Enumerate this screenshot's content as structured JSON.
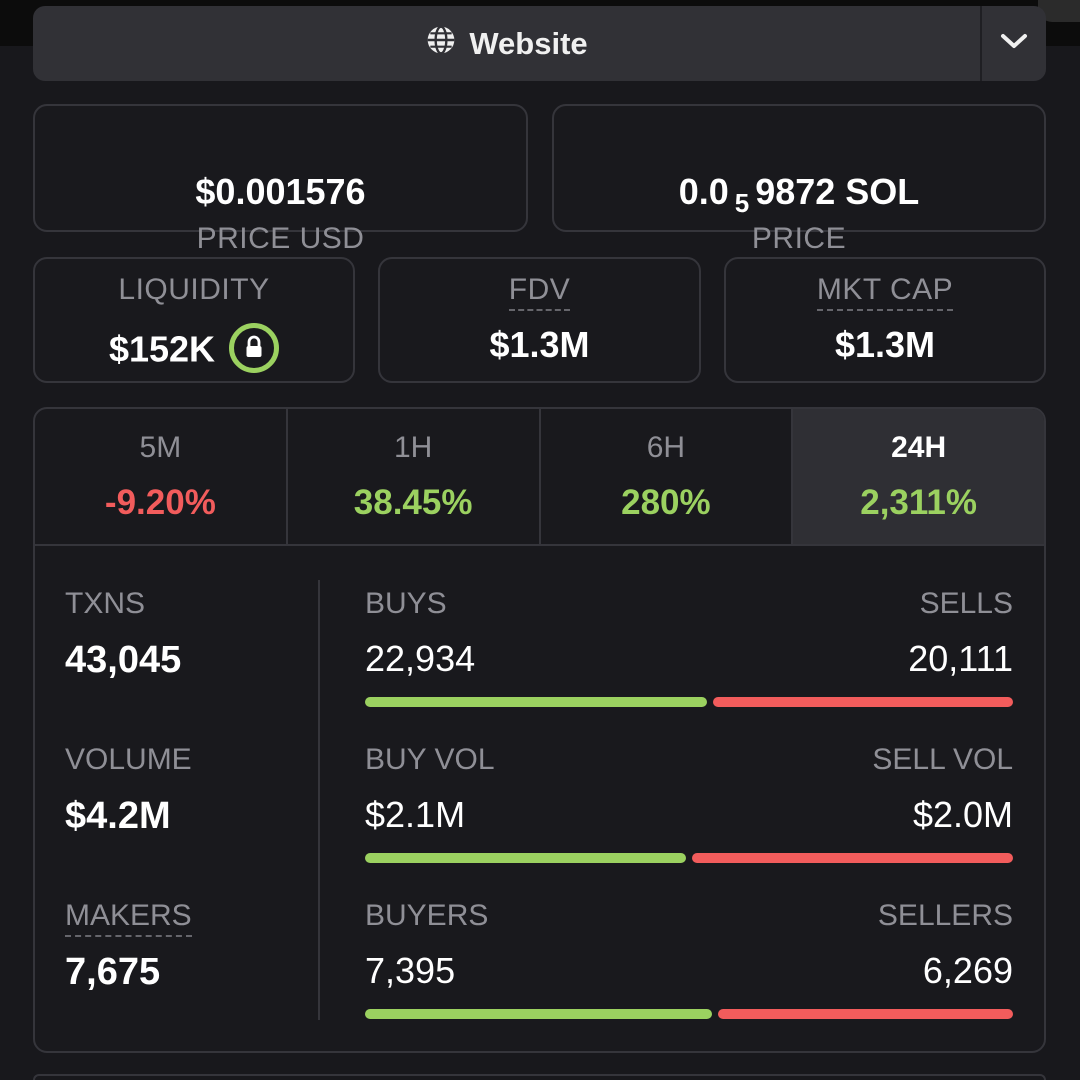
{
  "website_button": {
    "label": "Website",
    "icon": "globe-icon",
    "toggle_icon": "chevron-down-icon"
  },
  "price_usd": {
    "label": "PRICE USD",
    "value": "$0.001576"
  },
  "price_sol": {
    "label": "PRICE",
    "prefix": "0.0",
    "zeros_subscript": "5",
    "digits": "9872 SOL"
  },
  "liquidity": {
    "label": "LIQUIDITY",
    "value": "$152K",
    "lock_icon": "lock-icon"
  },
  "fdv": {
    "label": "FDV",
    "value": "$1.3M"
  },
  "mkt_cap": {
    "label": "MKT CAP",
    "value": "$1.3M"
  },
  "timeframes": [
    {
      "label": "5M",
      "change": "-9.20%",
      "color": "#f25c5c"
    },
    {
      "label": "1H",
      "change": "38.45%",
      "color": "#9bd160"
    },
    {
      "label": "6H",
      "change": "280%",
      "color": "#9bd160"
    },
    {
      "label": "24H",
      "change": "2,311%",
      "color": "#9bd160",
      "active": true
    }
  ],
  "txns": {
    "label": "TXNS",
    "value": "43,045"
  },
  "volume": {
    "label": "VOLUME",
    "value": "$4.2M"
  },
  "makers": {
    "label": "MAKERS",
    "value": "7,675"
  },
  "buys_sells": {
    "buy_label": "BUYS",
    "buy_value": "22,934",
    "sell_label": "SELLS",
    "sell_value": "20,111",
    "buy_fraction": 0.533
  },
  "vol_split": {
    "buy_label": "BUY VOL",
    "buy_value": "$2.1M",
    "sell_label": "SELL VOL",
    "sell_value": "$2.0M",
    "buy_fraction": 0.5
  },
  "buyers_sellers": {
    "buy_label": "BUYERS",
    "buy_value": "7,395",
    "sell_label": "SELLERS",
    "sell_value": "6,269",
    "buy_fraction": 0.541
  },
  "colors": {
    "positive": "#9bd160",
    "negative": "#f25c5c",
    "background": "#18181c"
  }
}
